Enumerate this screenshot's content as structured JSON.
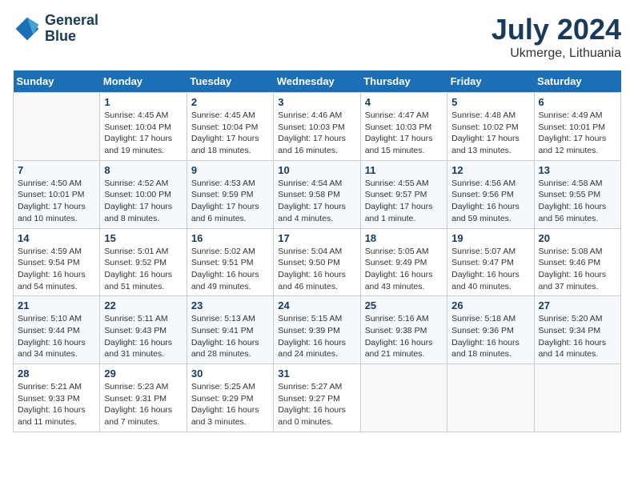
{
  "header": {
    "logo_line1": "General",
    "logo_line2": "Blue",
    "month_year": "July 2024",
    "location": "Ukmerge, Lithuania"
  },
  "calendar": {
    "days_of_week": [
      "Sunday",
      "Monday",
      "Tuesday",
      "Wednesday",
      "Thursday",
      "Friday",
      "Saturday"
    ],
    "weeks": [
      [
        {
          "day": "",
          "info": ""
        },
        {
          "day": "1",
          "info": "Sunrise: 4:45 AM\nSunset: 10:04 PM\nDaylight: 17 hours\nand 19 minutes."
        },
        {
          "day": "2",
          "info": "Sunrise: 4:45 AM\nSunset: 10:04 PM\nDaylight: 17 hours\nand 18 minutes."
        },
        {
          "day": "3",
          "info": "Sunrise: 4:46 AM\nSunset: 10:03 PM\nDaylight: 17 hours\nand 16 minutes."
        },
        {
          "day": "4",
          "info": "Sunrise: 4:47 AM\nSunset: 10:03 PM\nDaylight: 17 hours\nand 15 minutes."
        },
        {
          "day": "5",
          "info": "Sunrise: 4:48 AM\nSunset: 10:02 PM\nDaylight: 17 hours\nand 13 minutes."
        },
        {
          "day": "6",
          "info": "Sunrise: 4:49 AM\nSunset: 10:01 PM\nDaylight: 17 hours\nand 12 minutes."
        }
      ],
      [
        {
          "day": "7",
          "info": "Sunrise: 4:50 AM\nSunset: 10:01 PM\nDaylight: 17 hours\nand 10 minutes."
        },
        {
          "day": "8",
          "info": "Sunrise: 4:52 AM\nSunset: 10:00 PM\nDaylight: 17 hours\nand 8 minutes."
        },
        {
          "day": "9",
          "info": "Sunrise: 4:53 AM\nSunset: 9:59 PM\nDaylight: 17 hours\nand 6 minutes."
        },
        {
          "day": "10",
          "info": "Sunrise: 4:54 AM\nSunset: 9:58 PM\nDaylight: 17 hours\nand 4 minutes."
        },
        {
          "day": "11",
          "info": "Sunrise: 4:55 AM\nSunset: 9:57 PM\nDaylight: 17 hours\nand 1 minute."
        },
        {
          "day": "12",
          "info": "Sunrise: 4:56 AM\nSunset: 9:56 PM\nDaylight: 16 hours\nand 59 minutes."
        },
        {
          "day": "13",
          "info": "Sunrise: 4:58 AM\nSunset: 9:55 PM\nDaylight: 16 hours\nand 56 minutes."
        }
      ],
      [
        {
          "day": "14",
          "info": "Sunrise: 4:59 AM\nSunset: 9:54 PM\nDaylight: 16 hours\nand 54 minutes."
        },
        {
          "day": "15",
          "info": "Sunrise: 5:01 AM\nSunset: 9:52 PM\nDaylight: 16 hours\nand 51 minutes."
        },
        {
          "day": "16",
          "info": "Sunrise: 5:02 AM\nSunset: 9:51 PM\nDaylight: 16 hours\nand 49 minutes."
        },
        {
          "day": "17",
          "info": "Sunrise: 5:04 AM\nSunset: 9:50 PM\nDaylight: 16 hours\nand 46 minutes."
        },
        {
          "day": "18",
          "info": "Sunrise: 5:05 AM\nSunset: 9:49 PM\nDaylight: 16 hours\nand 43 minutes."
        },
        {
          "day": "19",
          "info": "Sunrise: 5:07 AM\nSunset: 9:47 PM\nDaylight: 16 hours\nand 40 minutes."
        },
        {
          "day": "20",
          "info": "Sunrise: 5:08 AM\nSunset: 9:46 PM\nDaylight: 16 hours\nand 37 minutes."
        }
      ],
      [
        {
          "day": "21",
          "info": "Sunrise: 5:10 AM\nSunset: 9:44 PM\nDaylight: 16 hours\nand 34 minutes."
        },
        {
          "day": "22",
          "info": "Sunrise: 5:11 AM\nSunset: 9:43 PM\nDaylight: 16 hours\nand 31 minutes."
        },
        {
          "day": "23",
          "info": "Sunrise: 5:13 AM\nSunset: 9:41 PM\nDaylight: 16 hours\nand 28 minutes."
        },
        {
          "day": "24",
          "info": "Sunrise: 5:15 AM\nSunset: 9:39 PM\nDaylight: 16 hours\nand 24 minutes."
        },
        {
          "day": "25",
          "info": "Sunrise: 5:16 AM\nSunset: 9:38 PM\nDaylight: 16 hours\nand 21 minutes."
        },
        {
          "day": "26",
          "info": "Sunrise: 5:18 AM\nSunset: 9:36 PM\nDaylight: 16 hours\nand 18 minutes."
        },
        {
          "day": "27",
          "info": "Sunrise: 5:20 AM\nSunset: 9:34 PM\nDaylight: 16 hours\nand 14 minutes."
        }
      ],
      [
        {
          "day": "28",
          "info": "Sunrise: 5:21 AM\nSunset: 9:33 PM\nDaylight: 16 hours\nand 11 minutes."
        },
        {
          "day": "29",
          "info": "Sunrise: 5:23 AM\nSunset: 9:31 PM\nDaylight: 16 hours\nand 7 minutes."
        },
        {
          "day": "30",
          "info": "Sunrise: 5:25 AM\nSunset: 9:29 PM\nDaylight: 16 hours\nand 3 minutes."
        },
        {
          "day": "31",
          "info": "Sunrise: 5:27 AM\nSunset: 9:27 PM\nDaylight: 16 hours\nand 0 minutes."
        },
        {
          "day": "",
          "info": ""
        },
        {
          "day": "",
          "info": ""
        },
        {
          "day": "",
          "info": ""
        }
      ]
    ]
  }
}
